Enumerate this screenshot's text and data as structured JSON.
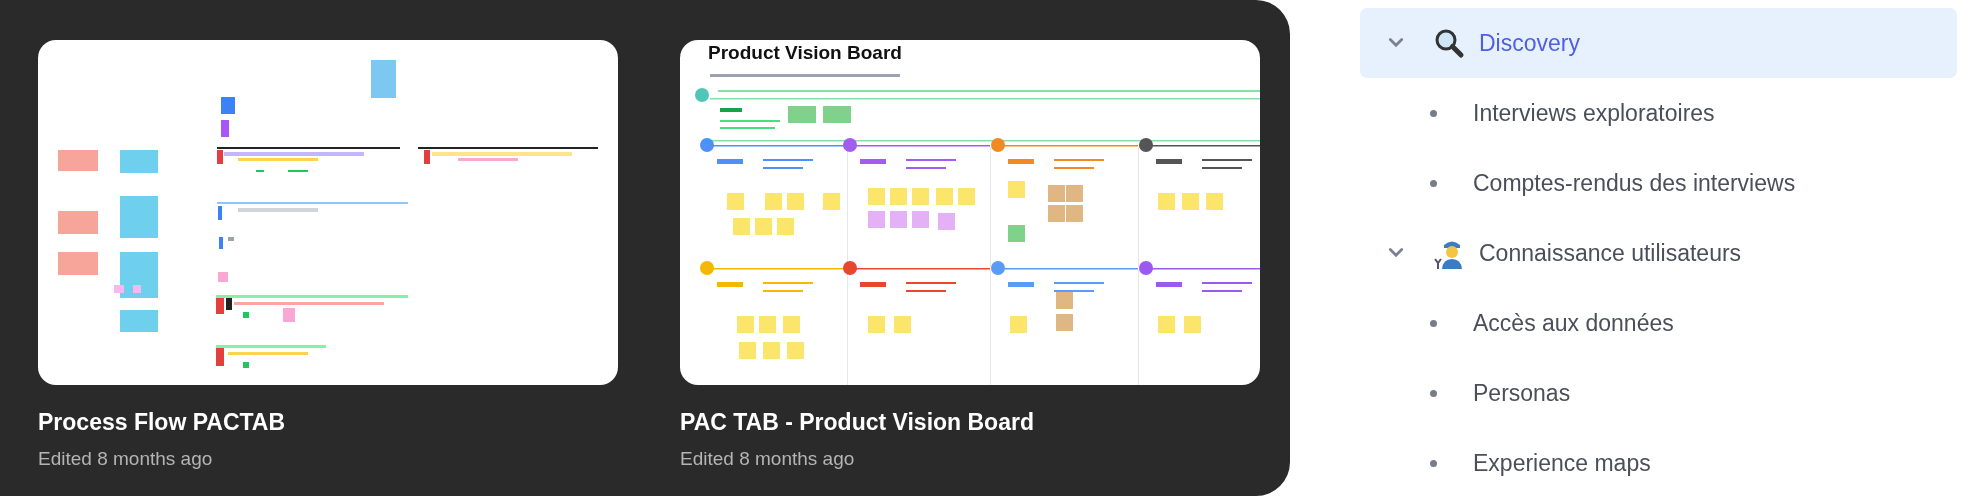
{
  "boards": [
    {
      "kind": "process-flow",
      "title": "Process Flow PACTAB",
      "edited": "Edited 8 months ago"
    },
    {
      "kind": "vision-board",
      "preview_heading": "Product Vision Board",
      "title": "PAC TAB - Product Vision Board",
      "edited": "Edited 8 months ago"
    }
  ],
  "tree": [
    {
      "label": "Discovery",
      "selected": true,
      "expanded": true,
      "children": [
        {
          "label": "Interviews exploratoires",
          "selected": false
        },
        {
          "label": "Comptes-rendus des interviews",
          "selected": false
        }
      ]
    },
    {
      "label": "Connaissance utilisateurs",
      "selected": false,
      "expanded": true,
      "children": [
        {
          "label": "Accès aux données",
          "selected": false
        },
        {
          "label": "Personas",
          "selected": false
        },
        {
          "label": "Experience maps",
          "selected": false
        }
      ]
    }
  ]
}
